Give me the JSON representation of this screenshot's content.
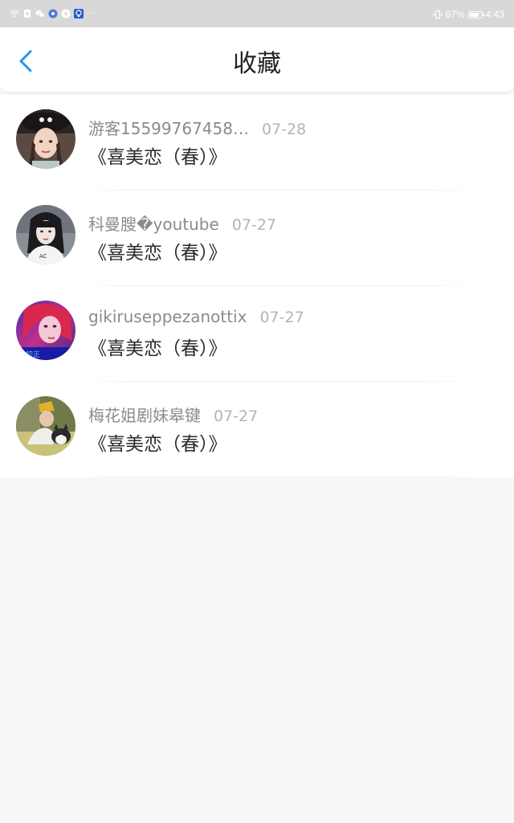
{
  "status_bar": {
    "battery_text": "87%",
    "battery_level": 0.87,
    "time": "4:43",
    "more_indicator": "···",
    "icons": [
      "wifi-icon",
      "sim-icon",
      "wechat-icon",
      "music-icon",
      "app-icon",
      "bulb-icon"
    ]
  },
  "header": {
    "title": "收藏",
    "back_icon": "chevron-left-icon",
    "accent_color": "#2196f3"
  },
  "favorites": [
    {
      "username": "游客15599767458…",
      "date": "07-28",
      "title": "《喜美恋（春）》"
    },
    {
      "username": "科曼膄�youtube",
      "date": "07-27",
      "title": "《喜美恋（春）》"
    },
    {
      "username": "gikiruseppezanottix",
      "date": "07-27",
      "title": "《喜美恋（春）》"
    },
    {
      "username": "梅花姐剧妹皋键",
      "date": "07-27",
      "title": "《喜美恋（春）》"
    }
  ]
}
